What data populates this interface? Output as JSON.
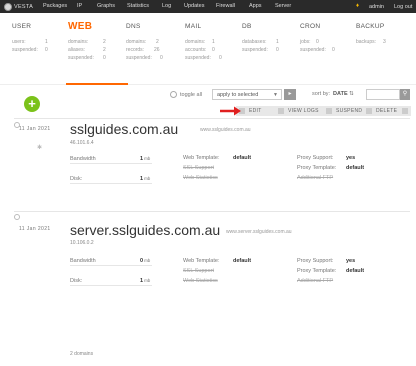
{
  "topbar": {
    "logo_text": "VESTA",
    "nav": [
      "Packages",
      "IP",
      "Graphs",
      "Statistics",
      "Log",
      "Updates",
      "Firewall",
      "Apps",
      "Server"
    ],
    "user": "admin",
    "logout": "Log out"
  },
  "stats": [
    {
      "title": "USER",
      "rows": [
        [
          "users:",
          "1"
        ],
        [
          "suspended:",
          "0"
        ]
      ]
    },
    {
      "title": "WEB",
      "rows": [
        [
          "domains:",
          "2"
        ],
        [
          "aliases:",
          "2"
        ],
        [
          "suspended:",
          "0"
        ]
      ]
    },
    {
      "title": "DNS",
      "rows": [
        [
          "domains:",
          "2"
        ],
        [
          "records:",
          "26"
        ],
        [
          "suspended:",
          "0"
        ]
      ]
    },
    {
      "title": "MAIL",
      "rows": [
        [
          "domains:",
          "1"
        ],
        [
          "accounts:",
          "0"
        ],
        [
          "suspended:",
          "0"
        ]
      ]
    },
    {
      "title": "DB",
      "rows": [
        [
          "databases:",
          "1"
        ],
        [
          "suspended:",
          "0"
        ]
      ]
    },
    {
      "title": "CRON",
      "rows": [
        [
          "jobs:",
          "0"
        ],
        [
          "suspended:",
          "0"
        ]
      ]
    },
    {
      "title": "BACKUP",
      "rows": [
        [
          "backups:",
          "3"
        ]
      ]
    }
  ],
  "toolbar": {
    "add_label": "+",
    "toggle_all": "toggle all",
    "apply_selected": "apply to selected",
    "sort_by": "sort by:",
    "sort_value": "DATE"
  },
  "actions": [
    "EDIT",
    "VIEW LOGS",
    "SUSPEND",
    "DELETE"
  ],
  "labels": {
    "bandwidth": "Bandwidth",
    "disk": "Disk:",
    "web_template": "Web Template:",
    "ssl_support": "SSL Support",
    "web_statistics": "Web Statistics",
    "proxy_support": "Proxy Support:",
    "proxy_template": "Proxy Template:",
    "additional_ftp": "Additional FTP",
    "mb": "mb"
  },
  "domains": [
    {
      "date": "11  Jan  2021",
      "name": "sslguides.com.au",
      "alias": "www.sslguides.com.au",
      "ip": "46.101.6.4",
      "bandwidth": "1",
      "disk": "1",
      "web_template": "default",
      "proxy_support": "yes",
      "proxy_template": "default"
    },
    {
      "date": "11  Jan  2021",
      "name": "server.sslguides.com.au",
      "alias": "www.server.sslguides.com.au",
      "ip": "10.106.0.2",
      "bandwidth": "0",
      "disk": "1",
      "web_template": "default",
      "proxy_support": "yes",
      "proxy_template": "default"
    }
  ],
  "footer": {
    "count": "2 domains"
  },
  "colors": {
    "accent": "#ff6701",
    "add_button": "#7bc21a",
    "arrow": "#e02020",
    "topbar": "#2a2a2a"
  }
}
